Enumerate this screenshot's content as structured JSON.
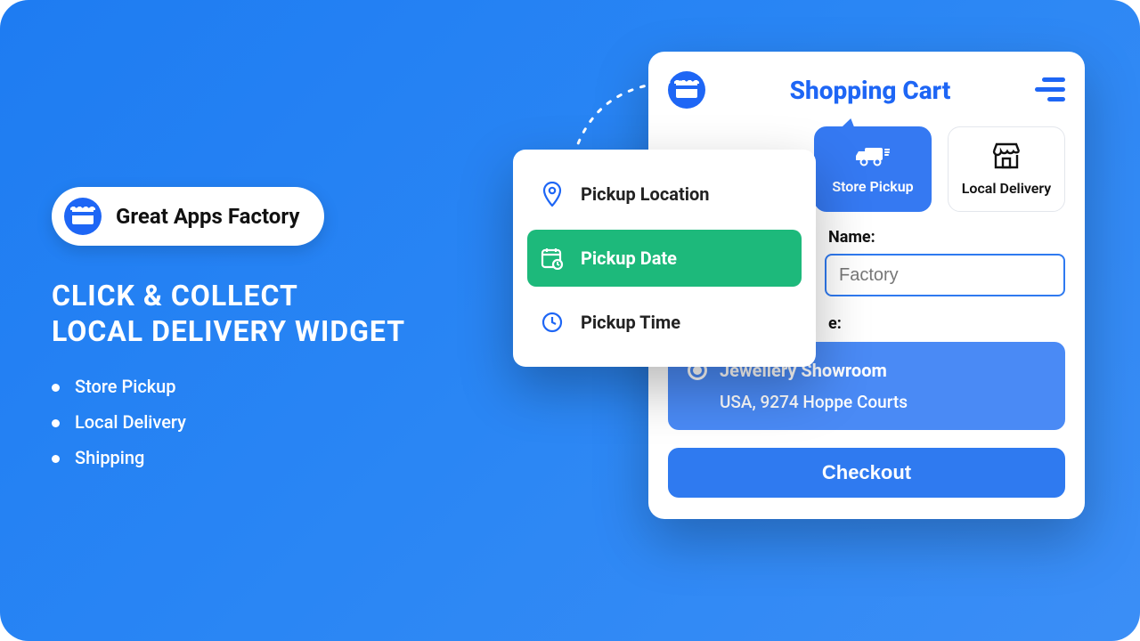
{
  "brand": {
    "name": "Great Apps Factory"
  },
  "headline_line1": "CLICK & COLLECT",
  "headline_line2": "LOCAL DELIVERY WIDGET",
  "features": [
    "Store Pickup",
    "Local Delivery",
    "Shipping"
  ],
  "cart": {
    "title": "Shopping Cart",
    "methods": {
      "store_pickup": "Store Pickup",
      "local_delivery": "Local Delivery"
    },
    "name_label": "Name:",
    "name_value": "Factory",
    "store_label": "e:",
    "store_option": {
      "name": "Jewellery Showroom",
      "address": "USA, 9274 Hoppe Courts"
    },
    "checkout": "Checkout"
  },
  "popover": {
    "location": "Pickup Location",
    "date": "Pickup Date",
    "time": "Pickup Time"
  }
}
